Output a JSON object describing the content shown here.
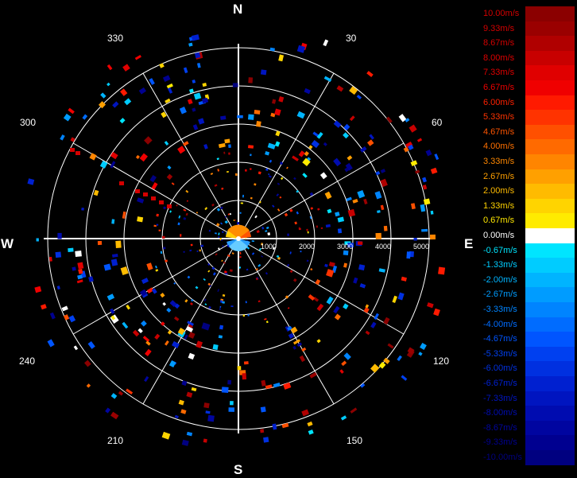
{
  "radar": {
    "cardinals": {
      "north": "N",
      "south": "S",
      "east": "E",
      "west": "W"
    },
    "azimuth_labels": [
      "30",
      "60",
      "120",
      "150",
      "210",
      "240",
      "300",
      "330"
    ],
    "range_labels": [
      "1000",
      "2000",
      "3000",
      "4000",
      "5000"
    ]
  },
  "legend": {
    "entries": [
      {
        "label": "10.00m/s",
        "color": "#8b0000",
        "text_color": "#d40000"
      },
      {
        "label": "9.33m/s",
        "color": "#9a0000",
        "text_color": "#d40000"
      },
      {
        "label": "8.67m/s",
        "color": "#b00000",
        "text_color": "#d40000"
      },
      {
        "label": "8.00m/s",
        "color": "#c80000",
        "text_color": "#e00000"
      },
      {
        "label": "7.33m/s",
        "color": "#e00000",
        "text_color": "#e00000"
      },
      {
        "label": "6.67m/s",
        "color": "#f00000",
        "text_color": "#f00000"
      },
      {
        "label": "6.00m/s",
        "color": "#ff1a00",
        "text_color": "#ff2000"
      },
      {
        "label": "5.33m/s",
        "color": "#ff3300",
        "text_color": "#ff3300"
      },
      {
        "label": "4.67m/s",
        "color": "#ff5000",
        "text_color": "#ff5500"
      },
      {
        "label": "4.00m/s",
        "color": "#ff6a00",
        "text_color": "#ff7000"
      },
      {
        "label": "3.33m/s",
        "color": "#ff8500",
        "text_color": "#ff8800"
      },
      {
        "label": "2.67m/s",
        "color": "#ffa000",
        "text_color": "#ffa000"
      },
      {
        "label": "2.00m/s",
        "color": "#ffbb00",
        "text_color": "#ffbb00"
      },
      {
        "label": "1.33m/s",
        "color": "#ffd400",
        "text_color": "#ffd400"
      },
      {
        "label": "0.67m/s",
        "color": "#ffeb00",
        "text_color": "#ffe800"
      },
      {
        "label": "0.00m/s",
        "color": "#ffffff",
        "text_color": "#ffffff"
      },
      {
        "label": "-0.67m/s",
        "color": "#00e5ff",
        "text_color": "#00e5ff"
      },
      {
        "label": "-1.33m/s",
        "color": "#00ccff",
        "text_color": "#00ccff"
      },
      {
        "label": "-2.00m/s",
        "color": "#00b4ff",
        "text_color": "#00b4ff"
      },
      {
        "label": "-2.67m/s",
        "color": "#009cff",
        "text_color": "#009cff"
      },
      {
        "label": "-3.33m/s",
        "color": "#0084ff",
        "text_color": "#0084ff"
      },
      {
        "label": "-4.00m/s",
        "color": "#006cff",
        "text_color": "#006cff"
      },
      {
        "label": "-4.67m/s",
        "color": "#0055ff",
        "text_color": "#0055ff"
      },
      {
        "label": "-5.33m/s",
        "color": "#0040f0",
        "text_color": "#0040f0"
      },
      {
        "label": "-6.00m/s",
        "color": "#0030e0",
        "text_color": "#0030e0"
      },
      {
        "label": "-6.67m/s",
        "color": "#0020d0",
        "text_color": "#0020d0"
      },
      {
        "label": "-7.33m/s",
        "color": "#0015c0",
        "text_color": "#0015c0"
      },
      {
        "label": "-8.00m/s",
        "color": "#000cb0",
        "text_color": "#000cb0"
      },
      {
        "label": "-8.67m/s",
        "color": "#0005a0",
        "text_color": "#0005a0"
      },
      {
        "label": "-9.33m/s",
        "color": "#000090",
        "text_color": "#000090"
      },
      {
        "label": "-10.00m/s",
        "color": "#000080",
        "text_color": "#000080"
      }
    ]
  }
}
